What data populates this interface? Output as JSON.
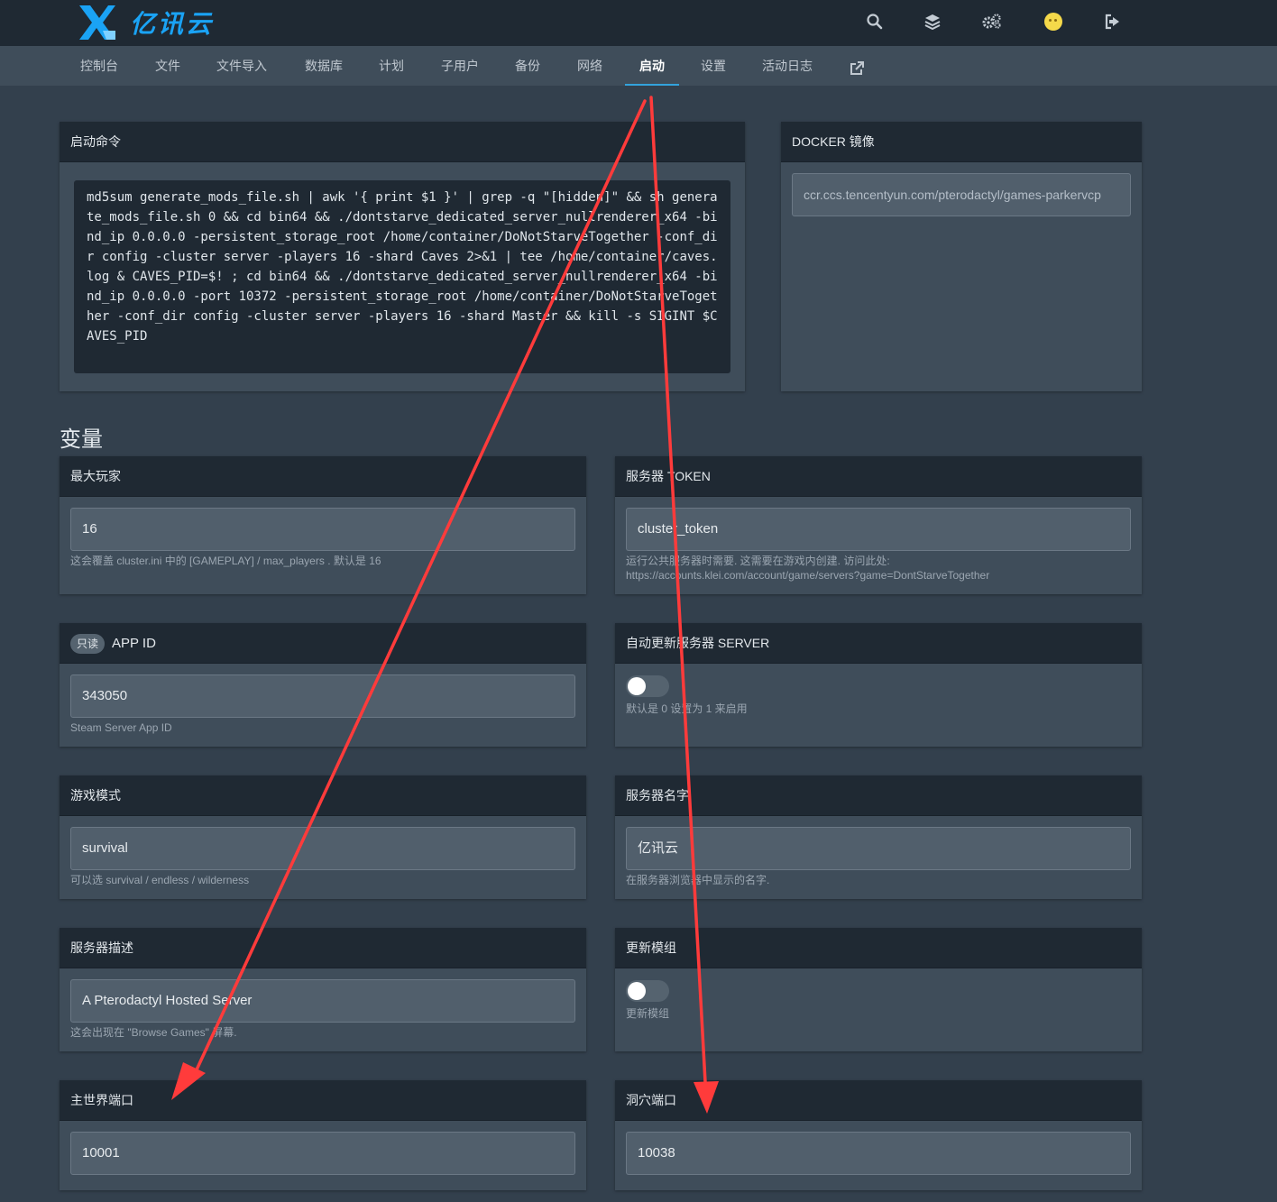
{
  "brand": {
    "name": "亿讯云",
    "accent": "#1aa3f5"
  },
  "top_icons": [
    "search-icon",
    "layers-icon",
    "settings-icon",
    "avatar",
    "logout-icon"
  ],
  "nav": {
    "items": [
      "控制台",
      "文件",
      "文件导入",
      "数据库",
      "计划",
      "子用户",
      "备份",
      "网络",
      "启动",
      "设置",
      "活动日志"
    ],
    "active": "启动",
    "external_icon": "external-link-icon"
  },
  "startup": {
    "title": "启动命令",
    "command": "md5sum generate_mods_file.sh | awk '{ print $1 }' | grep -q \"[hidden]\" && sh generate_mods_file.sh 0 && cd bin64 && ./dontstarve_dedicated_server_nullrenderer_x64 -bind_ip 0.0.0.0 -persistent_storage_root /home/container/DoNotStarveTogether -conf_dir config -cluster server -players 16 -shard Caves 2>&1 | tee /home/container/caves.log & CAVES_PID=$! ; cd bin64 && ./dontstarve_dedicated_server_nullrenderer_x64 -bind_ip 0.0.0.0 -port 10372 -persistent_storage_root /home/container/DoNotStarveTogether -conf_dir config -cluster server -players 16 -shard Master && kill -s SIGINT $CAVES_PID"
  },
  "docker": {
    "title": "DOCKER 镜像",
    "value": "ccr.ccs.tencentyun.com/pterodactyl/games-parkervcp"
  },
  "variables_title": "变量",
  "variables": {
    "max_players": {
      "title": "最大玩家",
      "value": "16",
      "help": "这会覆盖 cluster.ini 中的 [GAMEPLAY] / max_players . 默认是 16"
    },
    "server_token": {
      "title": "服务器 TOKEN",
      "value": "cluster_token",
      "help_1": "运行公共服务器时需要. 这需要在游戏内创建. 访问此处:",
      "help_2": "https://accounts.klei.com/account/game/servers?game=DontStarveTogether"
    },
    "app_id": {
      "badge": "只读",
      "title": "APP ID",
      "value": "343050",
      "help": "Steam Server App ID"
    },
    "auto_update": {
      "title": "自动更新服务器 SERVER",
      "enabled": false,
      "help": "默认是 0 设置为 1 来启用"
    },
    "game_mode": {
      "title": "游戏模式",
      "value": "survival",
      "help": "可以选 survival / endless / wilderness"
    },
    "server_name": {
      "title": "服务器名字",
      "value": "亿讯云",
      "help": "在服务器浏览器中显示的名字."
    },
    "server_desc": {
      "title": "服务器描述",
      "value": "A Pterodactyl Hosted Server",
      "help": "这会出现在 \"Browse Games\" 屏幕."
    },
    "update_mods": {
      "title": "更新模组",
      "enabled": false,
      "help": "更新模组"
    },
    "master_port": {
      "title": "主世界端口",
      "value": "10001"
    },
    "caves_port": {
      "title": "洞穴端口",
      "value": "10038"
    }
  },
  "annotation_color": "#ff3b3b"
}
